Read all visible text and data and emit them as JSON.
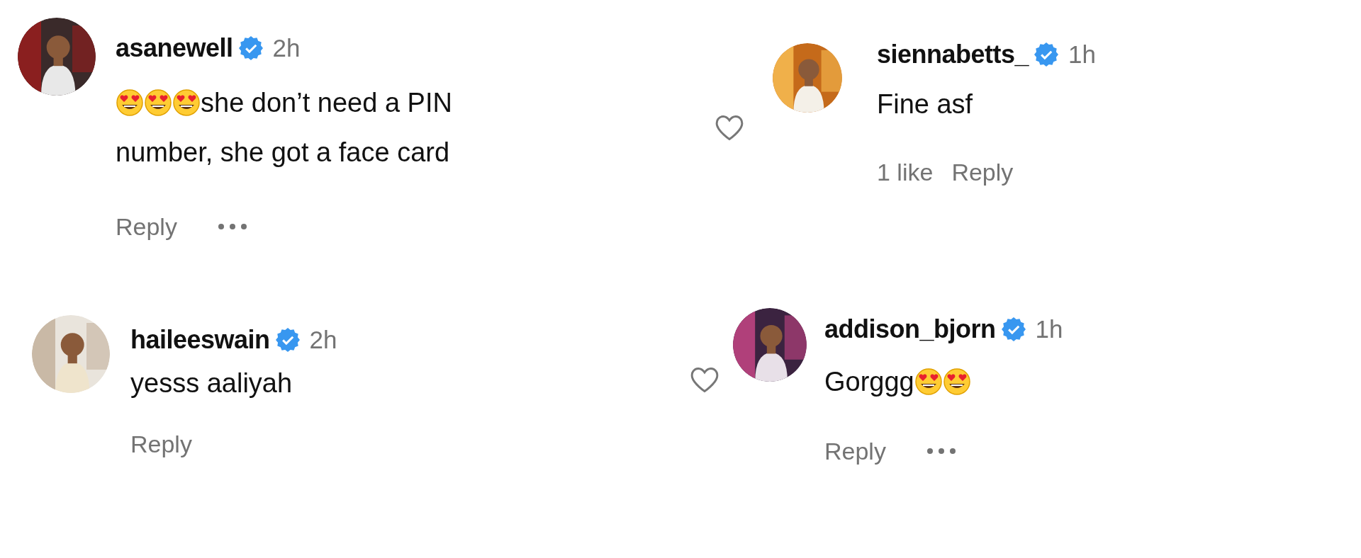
{
  "comments": [
    {
      "username": "asanewell",
      "verified": true,
      "time": "2h",
      "lines": [
        [
          {
            "kind": "emoji"
          },
          {
            "kind": "emoji"
          },
          {
            "kind": "emoji"
          },
          {
            "kind": "text",
            "text": "she don’t need a PIN"
          }
        ],
        [
          {
            "kind": "text",
            "text": "number, she got a face card"
          }
        ]
      ],
      "reply": "Reply",
      "more_menu": true,
      "like_button": false
    },
    {
      "username": "siennabetts_",
      "verified": true,
      "time": "1h",
      "lines": [
        [
          {
            "kind": "text",
            "text": "Fine asf"
          }
        ]
      ],
      "likes": "1 like",
      "reply": "Reply",
      "more_menu": false,
      "like_button": true
    },
    {
      "username": "haileeswain",
      "verified": true,
      "time": "2h",
      "lines": [
        [
          {
            "kind": "text",
            "text": "yesss aaliyah"
          }
        ]
      ],
      "reply": "Reply",
      "more_menu": false,
      "like_button": false
    },
    {
      "username": "addison_bjorn",
      "verified": true,
      "time": "1h",
      "lines": [
        [
          {
            "kind": "text",
            "text": "Gorggg"
          },
          {
            "kind": "emoji"
          },
          {
            "kind": "emoji"
          }
        ]
      ],
      "reply": "Reply",
      "more_menu": true,
      "like_button": true
    }
  ]
}
